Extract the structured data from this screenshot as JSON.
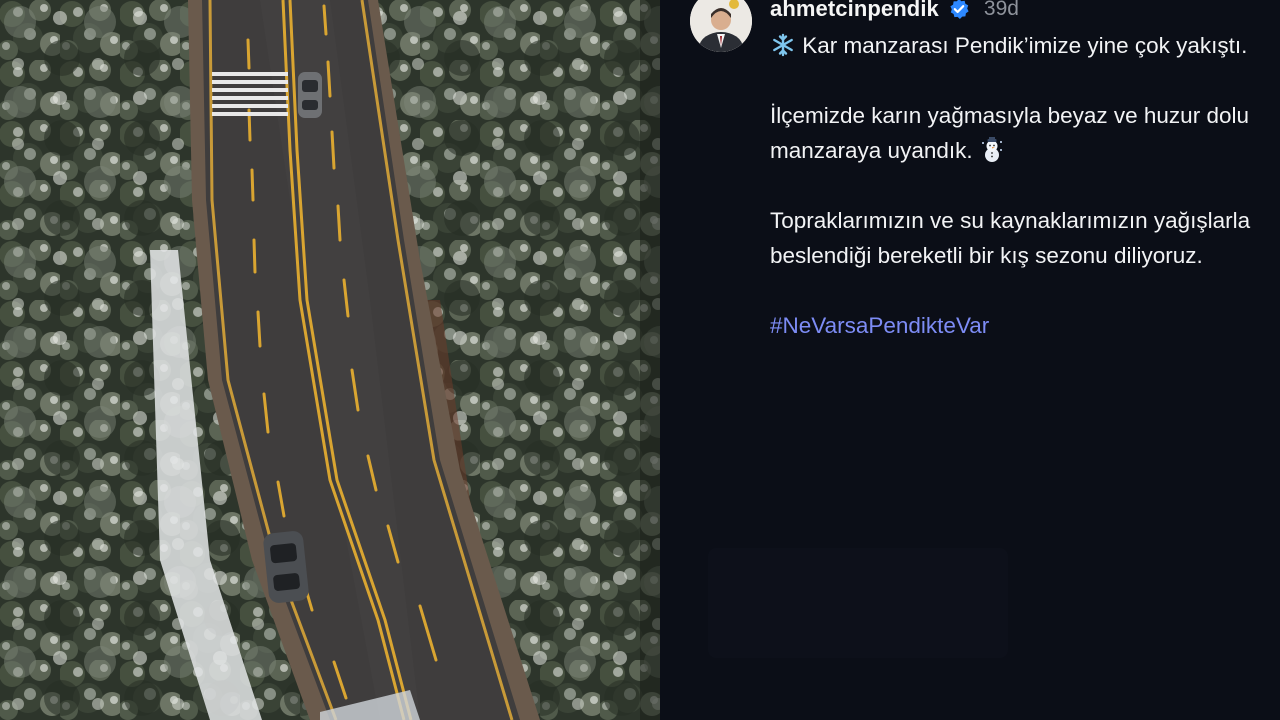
{
  "post": {
    "username": "ahmetcinpendik",
    "time": "39d",
    "line1": "Kar manzarası Pendik’imize yine çok yakıştı.",
    "line2": "İlçemizde karın yağmasıyla beyaz ve huzur dolu manzaraya uyandık.",
    "line3": "Topraklarımızın ve su kaynaklarımızın yağışlarla beslendiği bereketli bir kış sezonu diliyoruz.",
    "hashtag": "#NeVarsaPendikteVar"
  },
  "icons": {
    "verified": "verified-badge-icon",
    "snowflake": "snowflake-icon",
    "snowman": "snowman-icon"
  },
  "colors": {
    "panel_bg": "#0b0e17",
    "hashtag": "#7d8cf5",
    "verified": "#2d88ff",
    "road_line": "#d9a531"
  }
}
